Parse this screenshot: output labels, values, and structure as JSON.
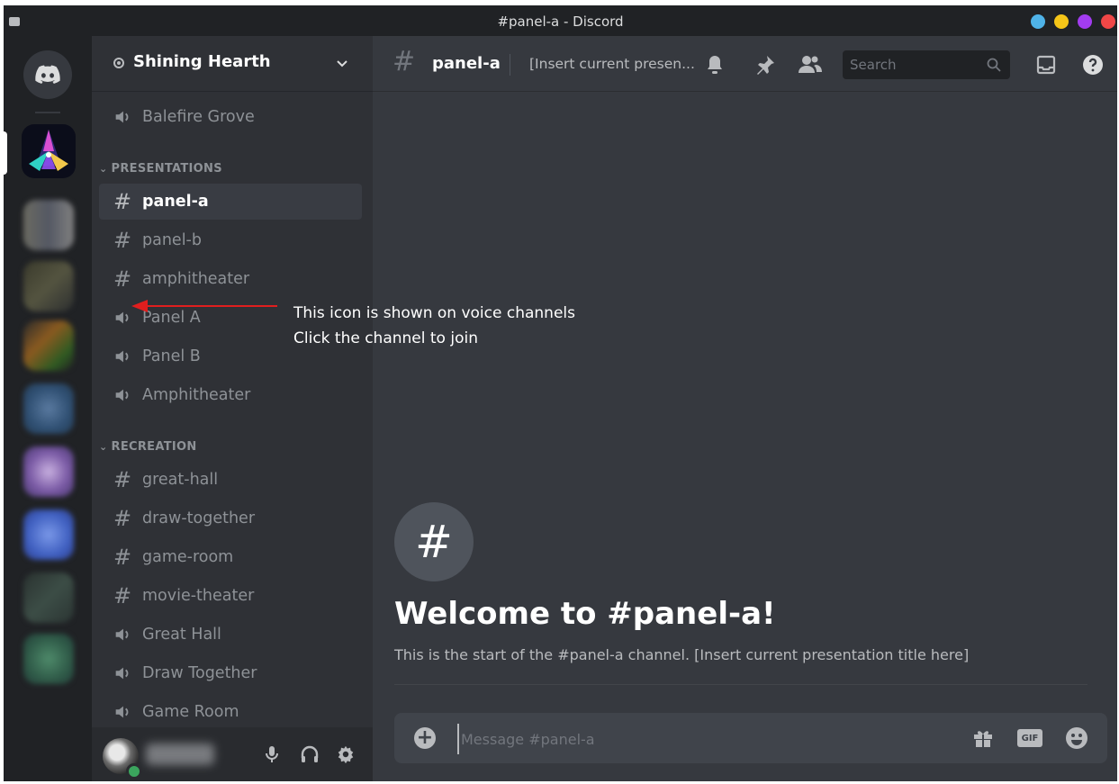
{
  "window": {
    "title": "#panel-a - Discord",
    "controls": [
      "#4fb3e8",
      "#f5c518",
      "#a23cf0",
      "#f04747"
    ]
  },
  "server": {
    "name": "Shining Hearth"
  },
  "channels": {
    "top": [
      {
        "type": "voice",
        "name": "Balefire Grove"
      }
    ],
    "categories": [
      {
        "name": "PRESENTATIONS",
        "items": [
          {
            "type": "text",
            "name": "panel-a",
            "selected": true
          },
          {
            "type": "text",
            "name": "panel-b"
          },
          {
            "type": "text",
            "name": "amphitheater"
          },
          {
            "type": "voice",
            "name": "Panel A"
          },
          {
            "type": "voice",
            "name": "Panel B"
          },
          {
            "type": "voice",
            "name": "Amphitheater"
          }
        ]
      },
      {
        "name": "RECREATION",
        "items": [
          {
            "type": "text",
            "name": "great-hall"
          },
          {
            "type": "text",
            "name": "draw-together"
          },
          {
            "type": "text",
            "name": "game-room"
          },
          {
            "type": "text",
            "name": "movie-theater"
          },
          {
            "type": "voice",
            "name": "Great Hall"
          },
          {
            "type": "voice",
            "name": "Draw Together"
          },
          {
            "type": "voice",
            "name": "Game Room"
          }
        ]
      }
    ]
  },
  "header": {
    "channel": "panel-a",
    "topic": "[Insert current presen...",
    "search_placeholder": "Search"
  },
  "welcome": {
    "title": "Welcome to #panel-a!",
    "description": "This is the start of the #panel-a channel. [Insert current presentation title here]"
  },
  "composer": {
    "placeholder": "Message #panel-a",
    "gif_label": "GIF"
  },
  "annotation": {
    "line1": "This icon is shown on voice channels",
    "line2": "Click the channel to join",
    "color": "#e01e1e"
  },
  "icons": {
    "voice": "speaker-icon",
    "text": "hash-icon"
  }
}
